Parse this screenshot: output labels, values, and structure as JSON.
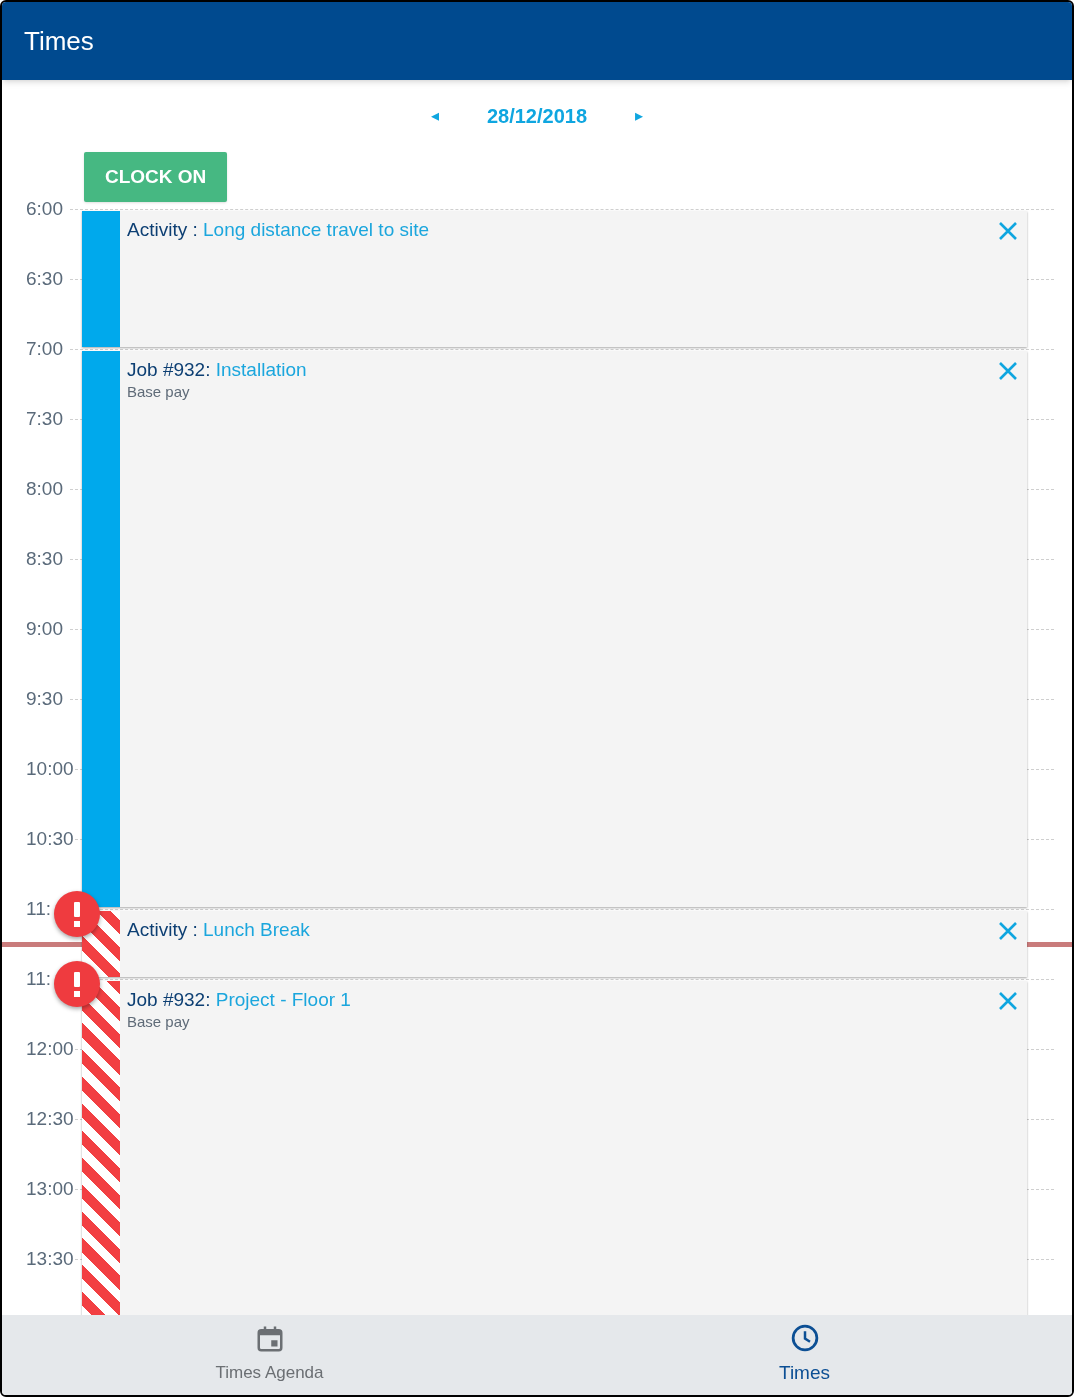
{
  "app_bar": {
    "title": "Times"
  },
  "date_nav": {
    "prev": "◂",
    "date": "28/12/2018",
    "next": "▸"
  },
  "clock_button": "CLOCK ON",
  "slots": [
    {
      "label": "6:00",
      "event": {
        "prefix": "Activity : ",
        "name": "Long distance travel to site",
        "conflict": false
      }
    },
    {
      "label": "6:30"
    },
    {
      "label": "7:00",
      "event": {
        "prefix": "Job #932: ",
        "name": "Installation",
        "subtitle": "Base pay",
        "conflict": false
      }
    },
    {
      "label": "7:30"
    },
    {
      "label": "8:00"
    },
    {
      "label": "8:30"
    },
    {
      "label": "9:00"
    },
    {
      "label": "9:30"
    },
    {
      "label": "10:00"
    },
    {
      "label": "10:30"
    },
    {
      "label": "11:",
      "event": {
        "prefix": "Activity : ",
        "name": "Lunch Break",
        "conflict": true
      }
    },
    {
      "label": "11:",
      "event": {
        "prefix": "Job #932: ",
        "name": "Project - Floor 1",
        "subtitle": "Base pay",
        "conflict": true
      }
    },
    {
      "label": "12:00"
    },
    {
      "label": "12:30"
    },
    {
      "label": "13:00"
    },
    {
      "label": "13:30"
    }
  ],
  "bottom_nav": [
    {
      "label": "Times Agenda",
      "selected": false
    },
    {
      "label": "Times",
      "selected": true
    }
  ]
}
